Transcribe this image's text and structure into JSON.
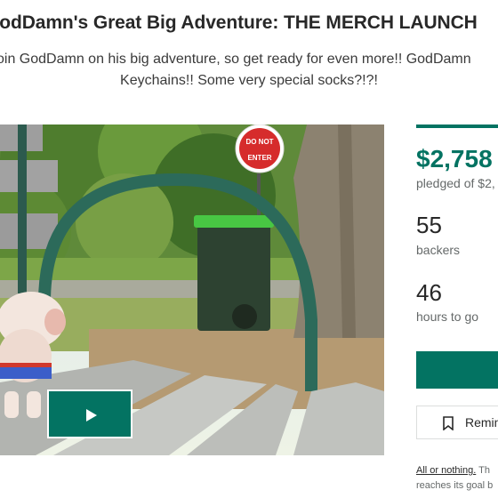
{
  "project": {
    "title": "GodDamn's Great Big Adventure: THE MERCH LAUNCH",
    "blurb_line1": "Join GodDamn on his big adventure, so get ready for even more!! GodDamn",
    "blurb_line2": "Keychains!! Some very special socks?!?!"
  },
  "media": {
    "sign_line1": "DO NOT",
    "sign_line2": "ENTER",
    "play_icon": "play-icon"
  },
  "stats": {
    "amount": "$2,758",
    "pledged_text": "pledged of $2,",
    "backers_count": "55",
    "backers_label": "backers",
    "hours_count": "46",
    "hours_label": "hours to go"
  },
  "actions": {
    "back_label": "",
    "remind_label": "Remin",
    "remind_icon": "bookmark-icon"
  },
  "funding_note": {
    "link": "All or nothing.",
    "rest": " Th",
    "line2": "reaches its goal b"
  },
  "colors": {
    "accent": "#037362",
    "text": "#282828",
    "muted": "#656969"
  }
}
